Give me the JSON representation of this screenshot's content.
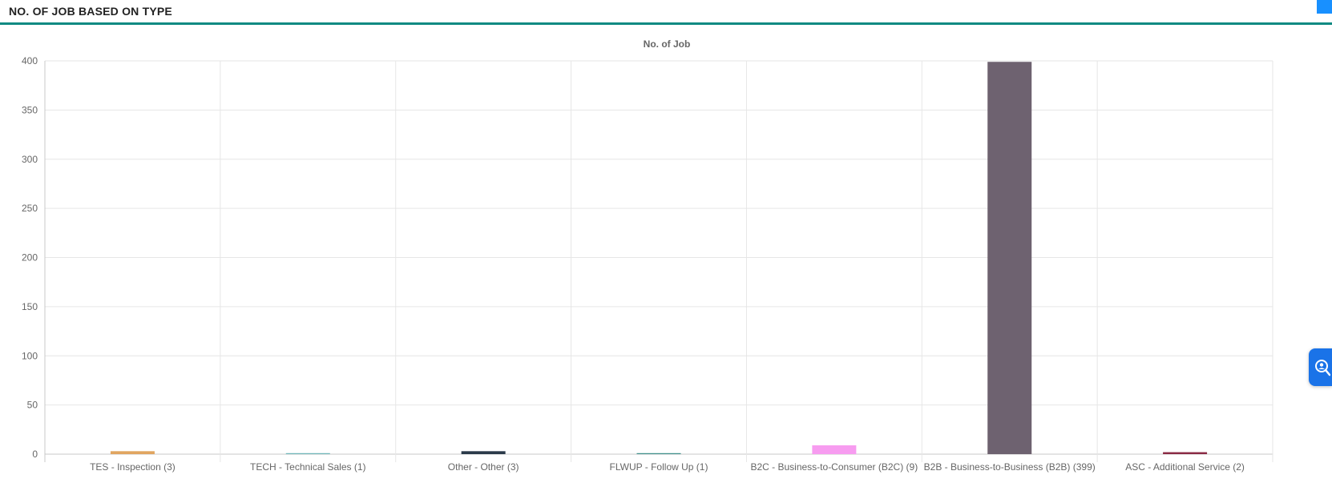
{
  "header": {
    "title": "NO. OF JOB BASED ON TYPE"
  },
  "colors": {
    "accent": "#0f8a82",
    "grid": "#e6e6e6",
    "axis": "#c8c8c8",
    "help_widget": "#1a73e8"
  },
  "help_widget": {
    "icon": "support-search-icon"
  },
  "chart_data": {
    "type": "bar",
    "title": "No. of Job",
    "xlabel": "",
    "ylabel": "",
    "ylim": [
      0,
      400
    ],
    "yticks": [
      0,
      50,
      100,
      150,
      200,
      250,
      300,
      350,
      400
    ],
    "grid": true,
    "legend": "none",
    "categories": [
      "TES - Inspection (3)",
      "TECH - Technical Sales (1)",
      "Other - Other (3)",
      "FLWUP - Follow Up (1)",
      "B2C - Business-to-Consumer (B2C) (9)",
      "B2B - Business-to-Business (B2B) (399)",
      "ASC - Additional Service (2)"
    ],
    "values": [
      3,
      1,
      3,
      1,
      9,
      399,
      2
    ],
    "bar_colors": [
      "#e0a560",
      "#6fb6b8",
      "#2b3a4a",
      "#3f8f8a",
      "#f79cf0",
      "#6e6270",
      "#8a2b45"
    ]
  }
}
